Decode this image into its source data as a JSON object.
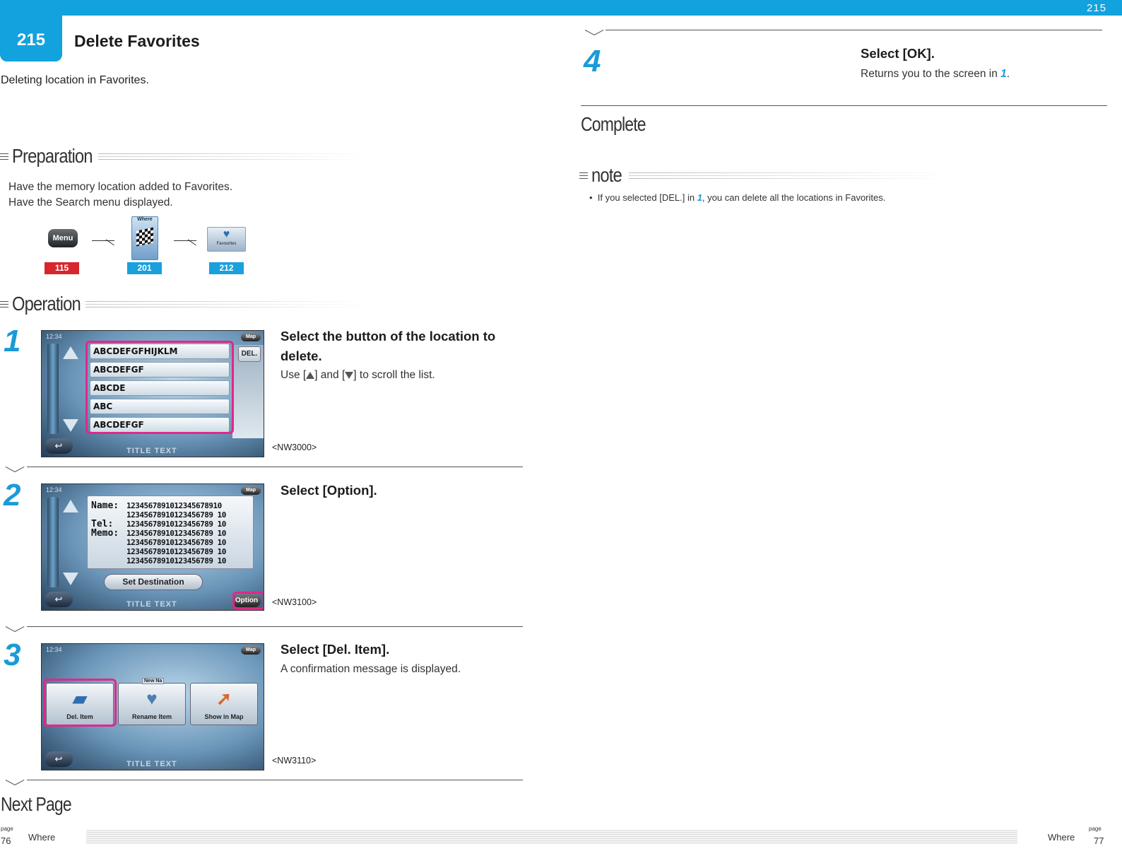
{
  "header": {
    "page_number_top": "215",
    "section_badge": "215",
    "section_title": "Delete Favorites",
    "lead": "Deleting location in Favorites.",
    "accent_color": "#12a2de"
  },
  "preparation": {
    "heading": "Preparation",
    "lines": [
      "Have the memory location added to Favorites.",
      "Have the Search menu displayed."
    ],
    "flow": [
      {
        "icon_label": "Menu",
        "icon": "menu-button-icon",
        "tag": "115",
        "tag_color": "#d7262d"
      },
      {
        "icon_label": "Where",
        "icon": "checkered-flag-icon",
        "tag": "201",
        "tag_color": "#1aa0dc"
      },
      {
        "icon_label": "Favourites",
        "icon": "favorites-heart-icon",
        "tag": "212",
        "tag_color": "#1aa0dc"
      }
    ]
  },
  "operation": {
    "heading": "Operation",
    "steps": [
      {
        "number": "1",
        "title": "Select the button of the location to delete.",
        "desc_before": "Use [",
        "desc_mid": "] and [",
        "desc_after": "] to scroll the list.",
        "screen_code": "<NW3000>",
        "screen": {
          "clock": "12:34",
          "map_btn": "Map",
          "rows": [
            "ABCDEFGFHIJKLM",
            "ABCDEFGF",
            "ABCDE",
            "ABC",
            "ABCDEFGF"
          ],
          "del_btn": "DEL.",
          "title_text": "TITLE TEXT"
        }
      },
      {
        "number": "2",
        "title": "Select [Option].",
        "screen_code": "<NW3100>",
        "screen": {
          "clock": "12:34",
          "map_btn": "Map",
          "labels": [
            "Name:",
            "Tel:",
            "Memo:"
          ],
          "values": [
            "1234567891012345678910",
            "12345678910123456789 10",
            "12345678910123456789 10",
            "12345678910123456789 10",
            "12345678910123456789 10",
            "12345678910123456789 10",
            "12345678910123456789 10"
          ],
          "set_destination": "Set Destination",
          "option_btn": "Option",
          "title_text": "TITLE TEXT"
        }
      },
      {
        "number": "3",
        "title": "Select [Del. Item].",
        "desc": "A confirmation message is displayed.",
        "screen_code": "<NW3110>",
        "screen": {
          "clock": "12:34",
          "map_btn": "Map",
          "tiles": [
            "Del. Item",
            "Rename Item",
            "Show in Map"
          ],
          "badge_new": "New Na",
          "title_text": "TITLE TEXT"
        }
      },
      {
        "number": "4",
        "title": "Select [OK].",
        "desc_before": "Returns you to the screen in ",
        "desc_ref": "1",
        "desc_after": "."
      }
    ]
  },
  "complete": "Complete",
  "note": {
    "heading": "note",
    "bullet_before": "If you selected [DEL.] in ",
    "bullet_ref": "1",
    "bullet_after": ", you can delete all the locations in Favorites."
  },
  "next_page": "Next Page",
  "footer": {
    "left_page_label": "page",
    "left_page_num": "76",
    "left_section": "Where",
    "right_page_label": "page",
    "right_page_num": "77",
    "right_section": "Where"
  }
}
